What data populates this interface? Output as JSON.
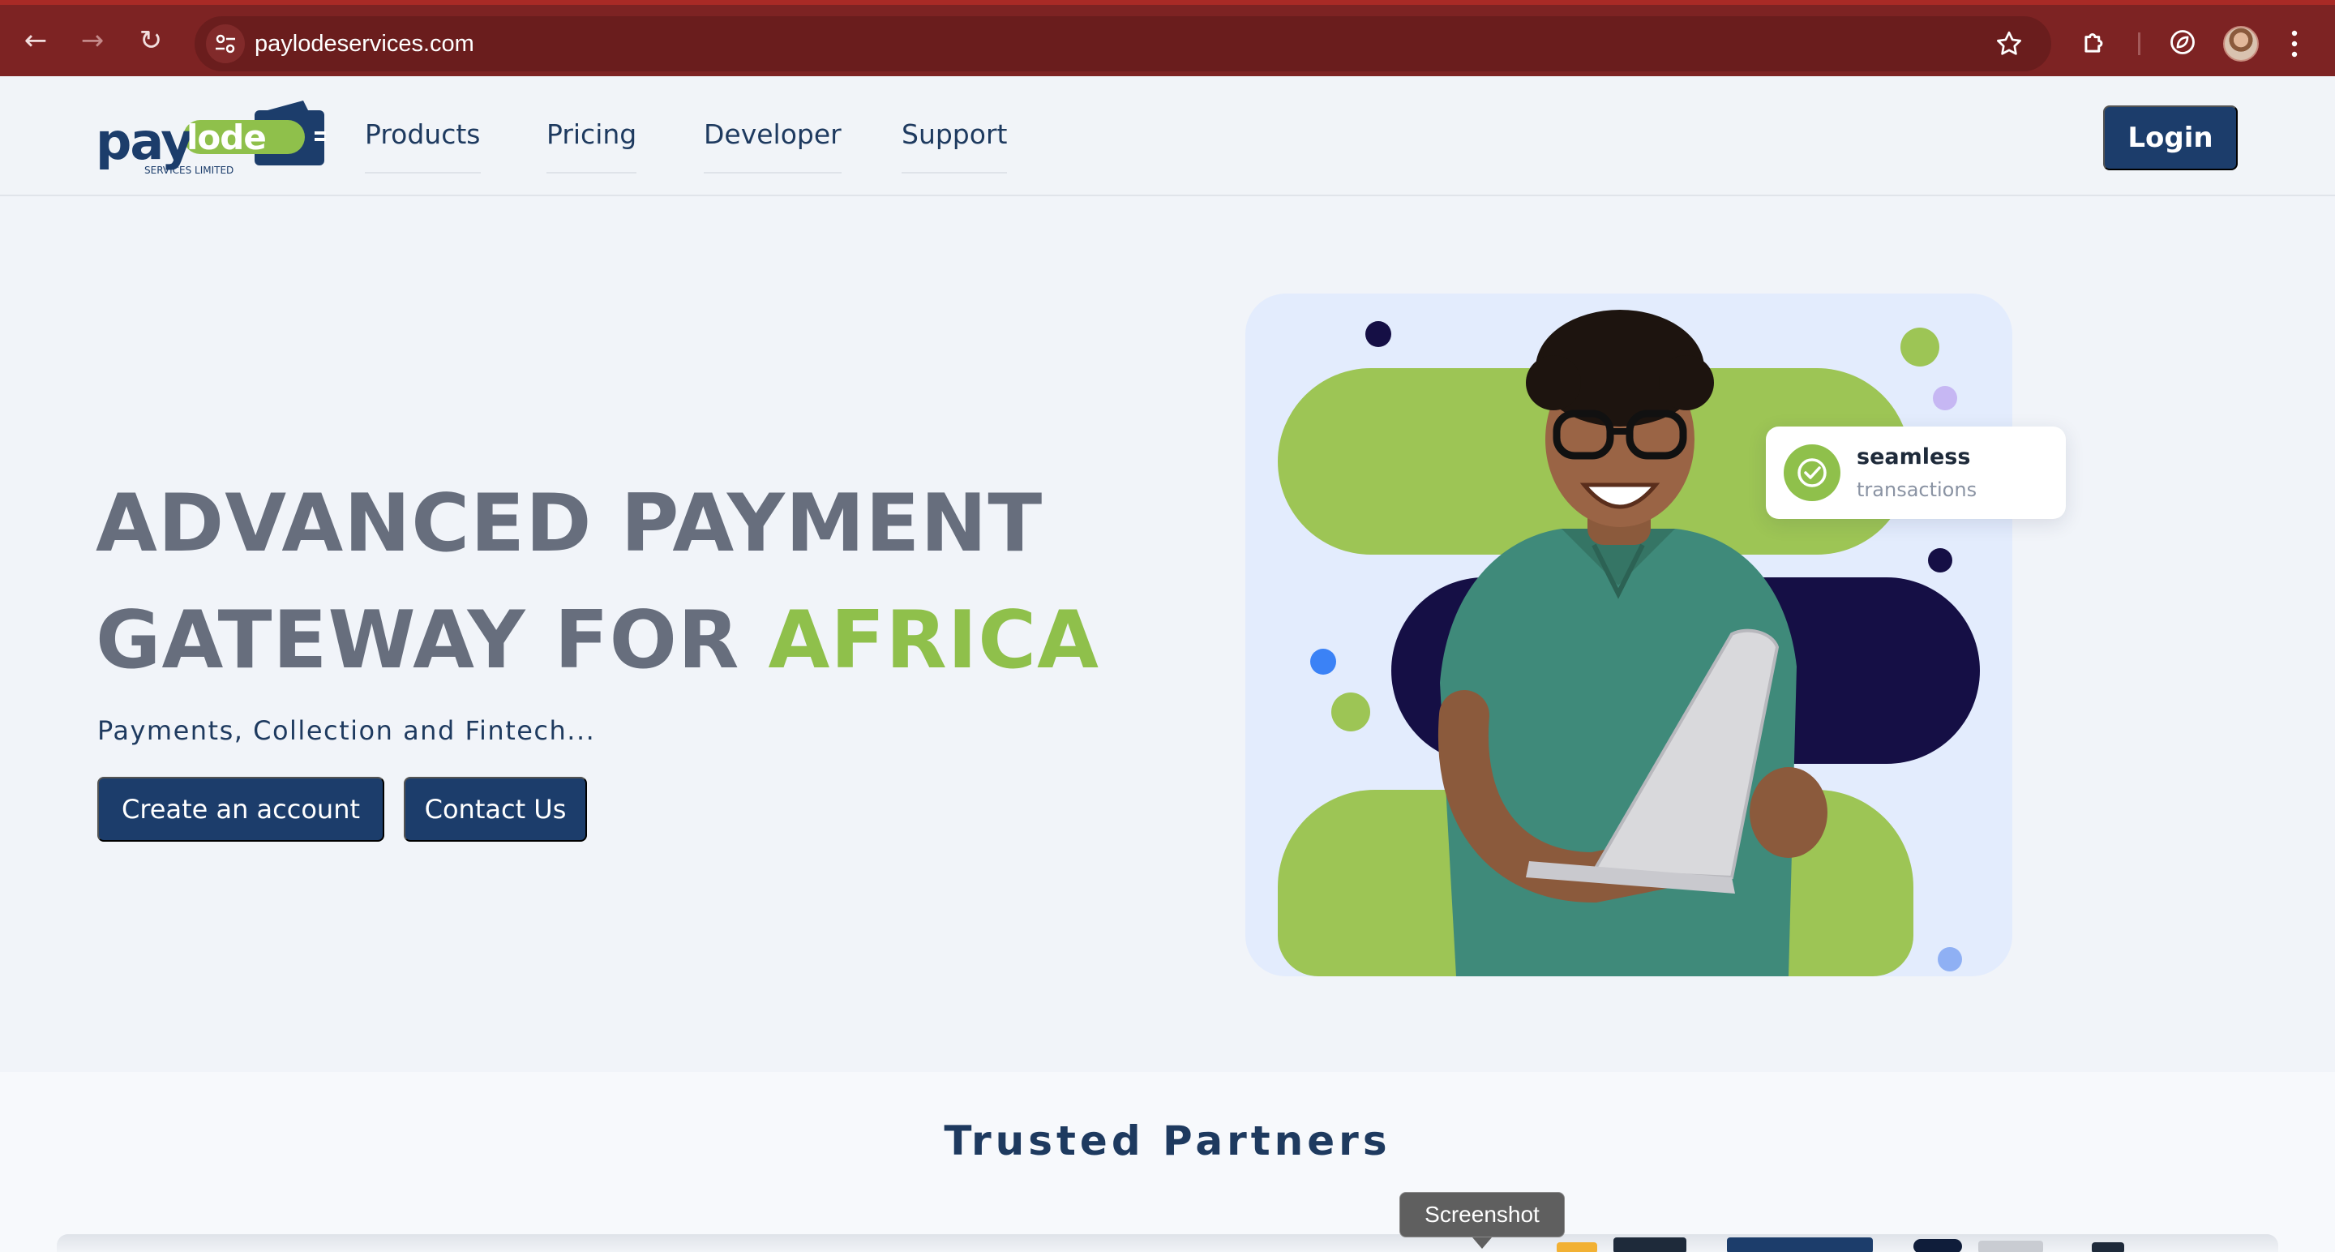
{
  "browser": {
    "url": "paylodeservices.com",
    "back_glyph": "←",
    "forward_glyph": "→",
    "reload_glyph": "↻"
  },
  "header": {
    "logo_text_pay": "pay",
    "logo_text_lode": "lode",
    "logo_tagline": "SERVICES LIMITED",
    "nav": {
      "products": "Products",
      "pricing": "Pricing",
      "developer": "Developer",
      "support": "Support"
    },
    "login_label": "Login"
  },
  "hero": {
    "title_line1": "ADVANCED PAYMENT",
    "title_line2_prefix": "GATEWAY FOR ",
    "title_line2_accent": "AFRICA",
    "subtitle": "Payments, Collection and Fintech...",
    "create_account_label": "Create an account",
    "contact_label": "Contact Us",
    "badge_title": "seamless",
    "badge_subtitle": "transactions"
  },
  "partners": {
    "title": "Trusted Partners"
  },
  "tooltip": {
    "label": "Screenshot"
  },
  "colors": {
    "browser_bar": "#7d2323",
    "brand_navy": "#1c3d6b",
    "brand_green": "#8fc04b",
    "title_gray": "#676e7d",
    "hero_bg": "#f1f4f9",
    "dark_pill": "#150f45"
  },
  "icons": {
    "site_info": "tune-icon",
    "bookmark": "star-icon",
    "extensions": "puzzle-icon",
    "performance": "leaf-icon",
    "menu": "kebab-menu-icon",
    "badge": "check-circle-icon"
  }
}
